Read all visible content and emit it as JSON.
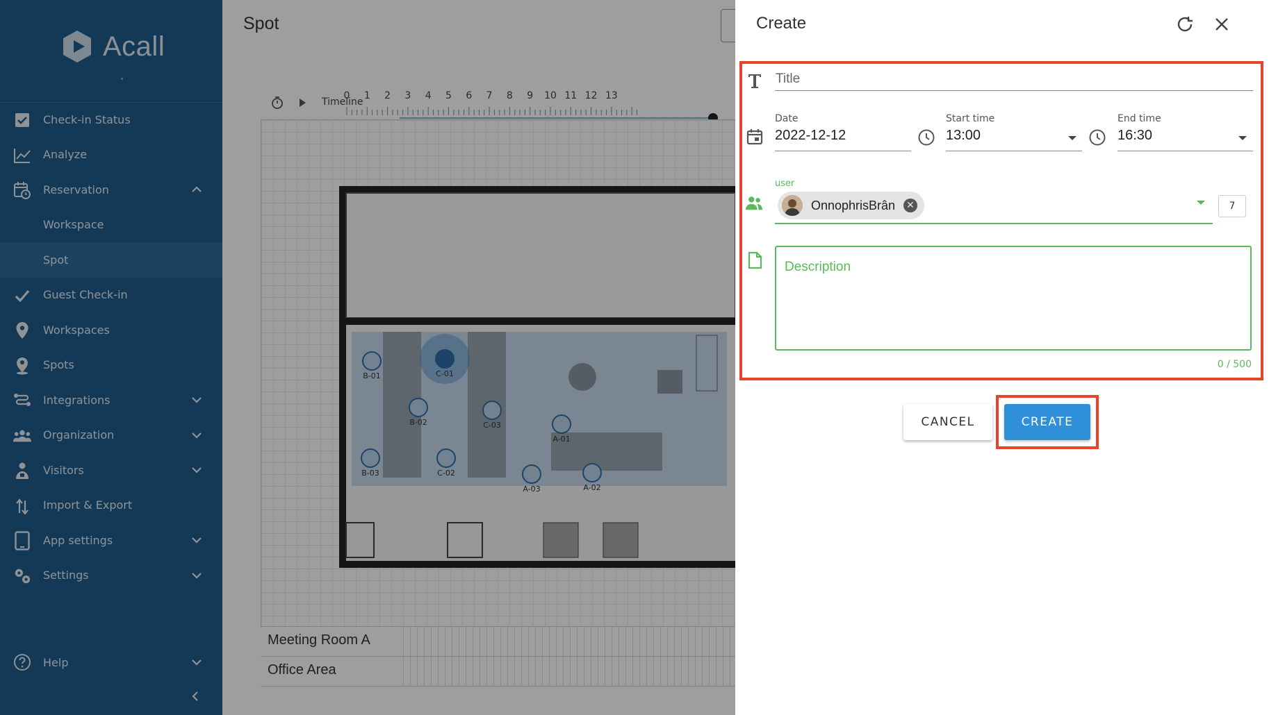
{
  "app": {
    "logo_text": "Acall"
  },
  "sidebar": {
    "items": [
      {
        "label": "Check-in Status",
        "icon": "checkbox-icon"
      },
      {
        "label": "Analyze",
        "icon": "chart-line-icon"
      },
      {
        "label": "Reservation",
        "icon": "calendar-clock-icon",
        "expanded": true
      },
      {
        "label": "Workspace",
        "sub": true
      },
      {
        "label": "Spot",
        "sub": true,
        "active": true
      },
      {
        "label": "Guest Check-in",
        "icon": "check-icon"
      },
      {
        "label": "Workspaces",
        "icon": "map-pin-icon"
      },
      {
        "label": "Spots",
        "icon": "person-pin-icon"
      },
      {
        "label": "Integrations",
        "icon": "integrations-icon",
        "collapsible": true
      },
      {
        "label": "Organization",
        "icon": "people-icon",
        "collapsible": true
      },
      {
        "label": "Visitors",
        "icon": "visitor-icon",
        "collapsible": true
      },
      {
        "label": "Import & Export",
        "icon": "import-export-icon"
      },
      {
        "label": "App settings",
        "icon": "tablet-icon",
        "collapsible": true
      },
      {
        "label": "Settings",
        "icon": "gears-icon",
        "collapsible": true
      }
    ],
    "help_label": "Help"
  },
  "main": {
    "page_title": "Spot",
    "timeline_label": "Timeline",
    "timeline_hours": [
      "0",
      "1",
      "2",
      "3",
      "4",
      "5",
      "6",
      "7",
      "8",
      "9",
      "10",
      "11",
      "12",
      "13"
    ],
    "spots": [
      "B-01",
      "C-01",
      "B-02",
      "C-03",
      "A-01",
      "B-03",
      "C-02",
      "A-03",
      "A-02"
    ],
    "rooms": [
      "Meeting Room A",
      "Office Area"
    ]
  },
  "panel": {
    "title": "Create",
    "title_placeholder": "Title",
    "date_label": "Date",
    "date_value": "2022-12-12",
    "start_label": "Start time",
    "start_value": "13:00",
    "end_label": "End time",
    "end_value": "16:30",
    "user_label": "user",
    "user_chip": "OnnophrisBrân",
    "user_count": "7",
    "description_placeholder": "Description",
    "char_counter": "0 / 500",
    "cancel_label": "CANCEL",
    "create_label": "CREATE"
  },
  "colors": {
    "sidebar_bg": "#1f5d8c",
    "accent": "#2f8fd8",
    "highlight": "#e8432b",
    "success": "#5cb85c"
  }
}
